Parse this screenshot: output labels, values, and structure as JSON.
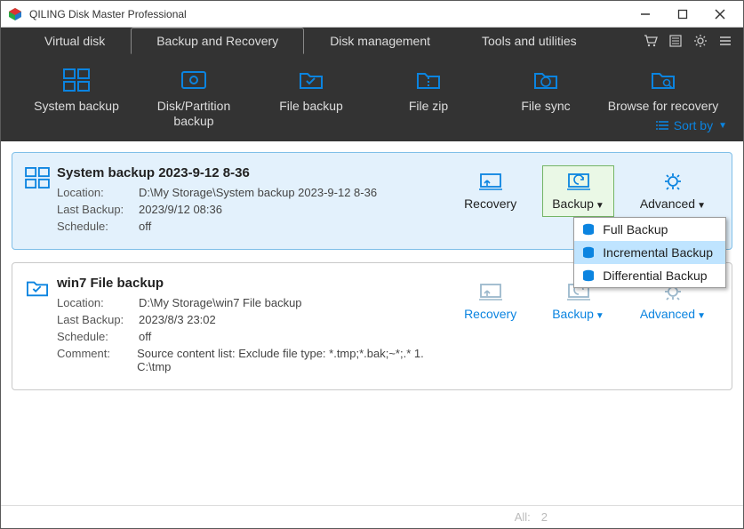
{
  "window": {
    "title": "QILING Disk Master Professional"
  },
  "tabs": [
    "Virtual disk",
    "Backup and Recovery",
    "Disk management",
    "Tools and utilities"
  ],
  "active_tab": 1,
  "toolbar": [
    {
      "label": "System backup"
    },
    {
      "label": "Disk/Partition backup"
    },
    {
      "label": "File backup"
    },
    {
      "label": "File zip"
    },
    {
      "label": "File sync"
    },
    {
      "label": "Browse for recovery"
    }
  ],
  "sort": {
    "label": "Sort by"
  },
  "backups": [
    {
      "title": "System backup 2023-9-12 8-36",
      "location_label": "Location:",
      "location": "D:\\My Storage\\System backup 2023-9-12 8-36",
      "last_label": "Last Backup:",
      "last": "2023/9/12 08:36",
      "schedule_label": "Schedule:",
      "schedule": "off",
      "actions": {
        "recovery": "Recovery",
        "backup": "Backup",
        "advanced": "Advanced"
      },
      "selected": true,
      "backup_active": true
    },
    {
      "title": "win7 File backup",
      "location_label": "Location:",
      "location": "D:\\My Storage\\win7 File backup",
      "last_label": "Last Backup:",
      "last": "2023/8/3 23:02",
      "schedule_label": "Schedule:",
      "schedule": "off",
      "comment_label": "Comment:",
      "comment": "Source content list:  Exclude file type: *.tmp;*.bak;~*;.*       1. C:\\tmp",
      "actions": {
        "recovery": "Recovery",
        "backup": "Backup",
        "advanced": "Advanced"
      },
      "selected": false
    }
  ],
  "backup_menu": {
    "items": [
      "Full Backup",
      "Incremental Backup",
      "Differential Backup"
    ],
    "hover_index": 1
  },
  "footer": {
    "all_label": "All:",
    "count": "2"
  },
  "colors": {
    "accent": "#0b84e0",
    "dark": "#333333",
    "selected_bg": "#e3f1fc",
    "menu_hover": "#bfe4ff"
  }
}
